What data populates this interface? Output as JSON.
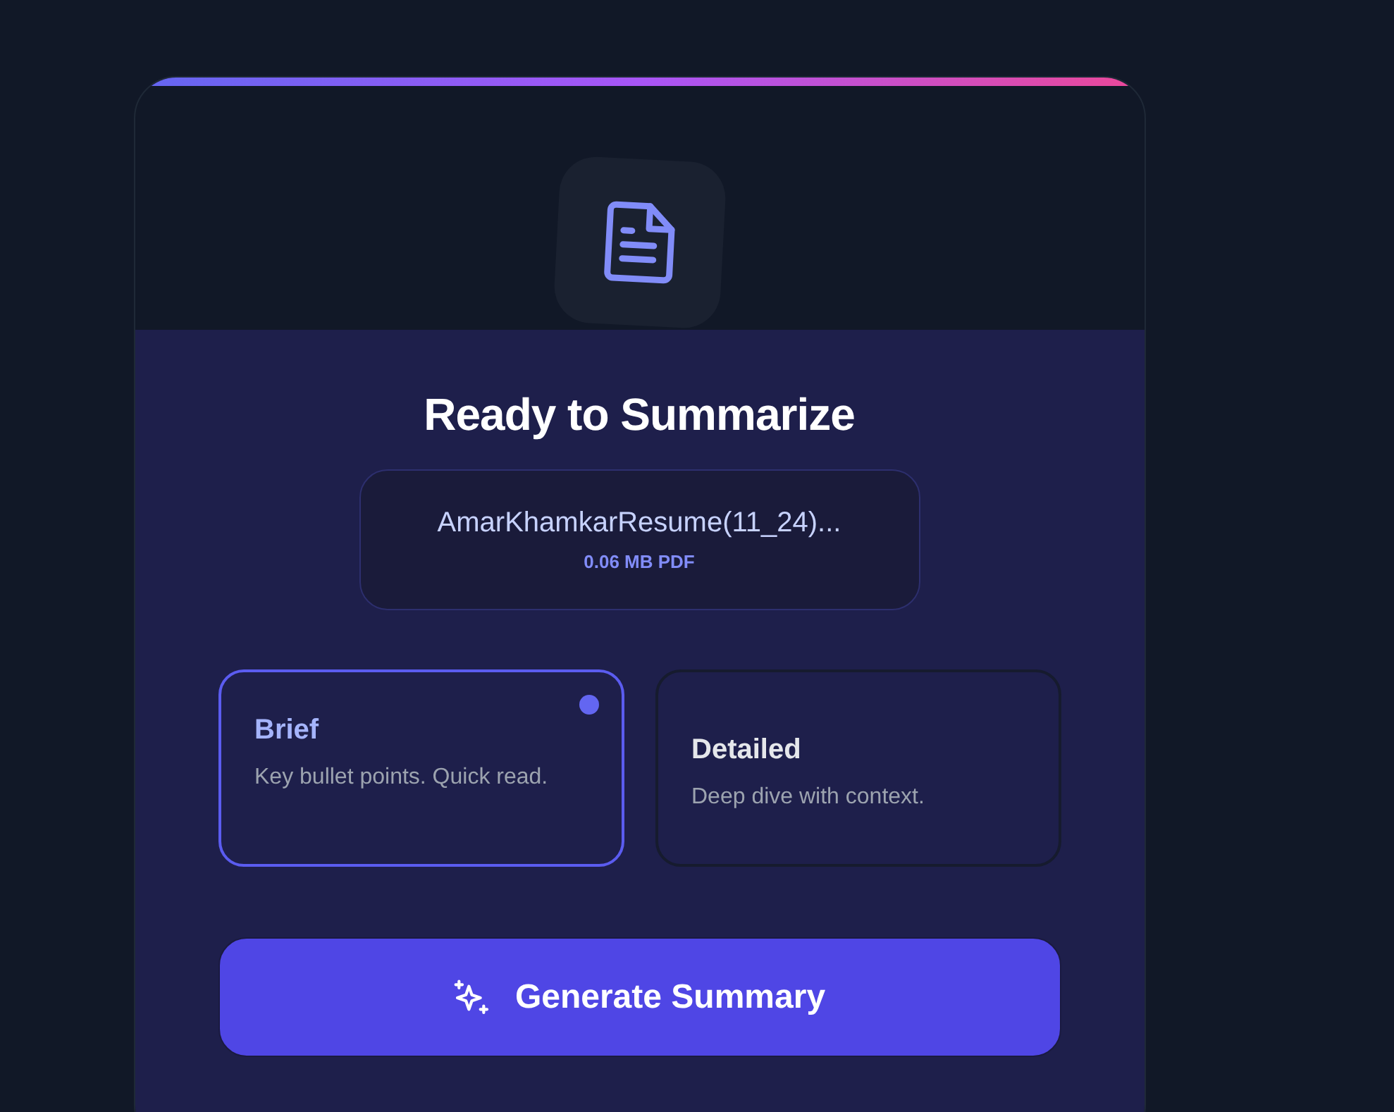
{
  "title": "Ready to Summarize",
  "file": {
    "name": "AmarKhamkarResume(11_24)...",
    "meta": "0.06 MB PDF"
  },
  "modes": [
    {
      "label": "Brief",
      "description": "Key bullet points. Quick read.",
      "selected": true
    },
    {
      "label": "Detailed",
      "description": "Deep dive with context.",
      "selected": false
    }
  ],
  "action": {
    "label": "Generate Summary"
  }
}
